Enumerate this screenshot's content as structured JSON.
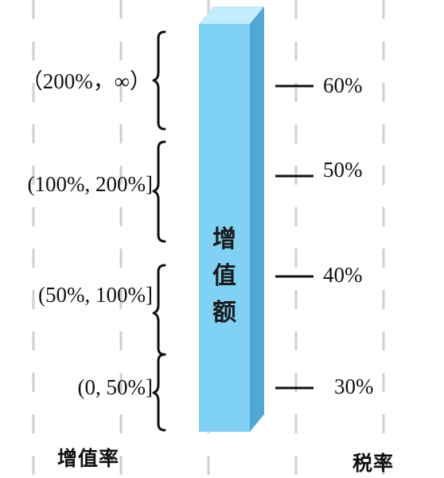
{
  "diagram": {
    "bar_label": [
      "增",
      "值",
      "额"
    ],
    "brackets": [
      {
        "range": "（200%，∞）",
        "rate": "60%"
      },
      {
        "range": "(100%, 200%]",
        "rate": "50%"
      },
      {
        "range": "(50%, 100%]",
        "rate": "40%"
      },
      {
        "range": "(0, 50%]",
        "rate": "30%"
      }
    ],
    "left_title": "增值率",
    "right_title": "税率",
    "colors": {
      "bar_front": "#7fd2f4",
      "bar_side": "#4fa9d3",
      "bar_top": "#c2ebfb",
      "grid": "#cfcfcf",
      "ink": "#111111"
    }
  }
}
